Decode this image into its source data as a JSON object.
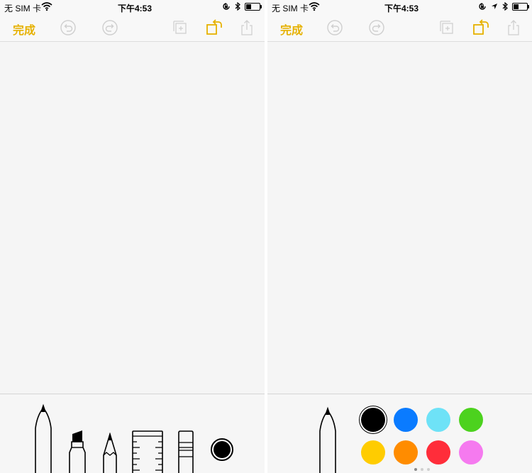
{
  "status_bar": {
    "carrier": "无 SIM 卡",
    "time": "下午4:53"
  },
  "nav": {
    "done_label": "完成"
  },
  "icons": {
    "undo": "undo-icon",
    "redo": "redo-icon",
    "add_page": "add-page-icon",
    "rotate": "rotate-icon",
    "share": "share-icon"
  },
  "tools": [
    "pen",
    "marker",
    "pencil",
    "ruler",
    "eraser",
    "color-picker"
  ],
  "palette": {
    "selected_color": "#000000",
    "colors": [
      "#000000",
      "#0a7bff",
      "#6ee2f7",
      "#4cd21e",
      "#ffcc00",
      "#ff8c00",
      "#ff2d3a",
      "#f57aef"
    ]
  },
  "colors": {
    "accent": "#e6b100",
    "disabled_icon": "#cfcfcf"
  }
}
